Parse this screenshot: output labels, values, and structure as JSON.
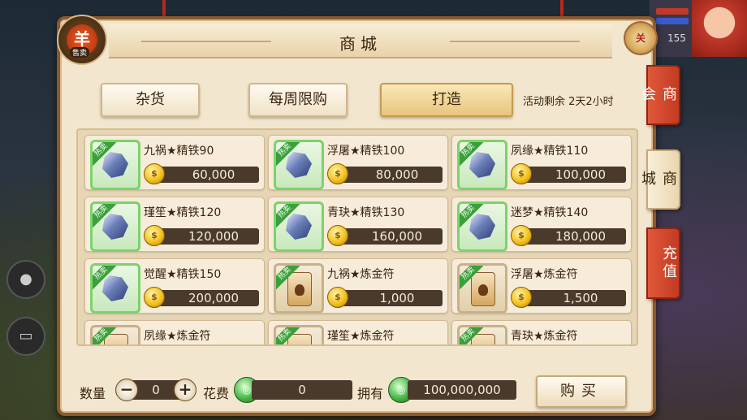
{
  "hud": {
    "level": "155"
  },
  "header": {
    "title": "商城",
    "npc_badge_glyph": "羊",
    "npc_badge_tag": "售卖",
    "close_label": "关"
  },
  "categories": [
    {
      "label": "杂货",
      "active": false
    },
    {
      "label": "每周限购",
      "active": false
    },
    {
      "label": "打造",
      "active": true
    }
  ],
  "activity_remaining": "活动剩余 2天2小时",
  "hot_tag": "热卖",
  "coin_icon": "coin-icon",
  "items": [
    {
      "name": "九祸★精铁90",
      "price": "60,000",
      "icon": "iron-ore-icon",
      "hot": true
    },
    {
      "name": "浮屠★精铁100",
      "price": "80,000",
      "icon": "iron-ore-icon",
      "hot": true
    },
    {
      "name": "夙缘★精铁110",
      "price": "100,000",
      "icon": "iron-ore-icon",
      "hot": true
    },
    {
      "name": "瑾笙★精铁120",
      "price": "120,000",
      "icon": "iron-ore-icon",
      "hot": true
    },
    {
      "name": "青玦★精铁130",
      "price": "160,000",
      "icon": "iron-ore-icon",
      "hot": true
    },
    {
      "name": "迷梦★精铁140",
      "price": "180,000",
      "icon": "iron-ore-icon",
      "hot": true
    },
    {
      "name": "觉醒★精铁150",
      "price": "200,000",
      "icon": "iron-ore-icon",
      "hot": true
    },
    {
      "name": "九祸★炼金符",
      "price": "1,000",
      "icon": "alchemy-talisman-icon",
      "hot": true
    },
    {
      "name": "浮屠★炼金符",
      "price": "1,500",
      "icon": "alchemy-talisman-icon",
      "hot": true
    },
    {
      "name": "夙缘★炼金符",
      "price": "",
      "icon": "alchemy-talisman-icon",
      "hot": true
    },
    {
      "name": "瑾笙★炼金符",
      "price": "",
      "icon": "alchemy-talisman-icon",
      "hot": true
    },
    {
      "name": "青玦★炼金符",
      "price": "",
      "icon": "alchemy-talisman-icon",
      "hot": true
    }
  ],
  "purchase": {
    "quantity_label": "数量",
    "quantity": "0",
    "minus": "−",
    "plus": "+",
    "cost_label": "花费",
    "cost": "0",
    "own_label": "拥有",
    "owned": "100,000,000",
    "buy_label": "购买"
  },
  "side_tabs": [
    {
      "label": "商会",
      "style": "red"
    },
    {
      "label": "商城",
      "style": "light"
    },
    {
      "label": "充值",
      "style": "red"
    }
  ],
  "colors": {
    "panel_bg": "#f2e6cf",
    "panel_border": "#8a5a2e",
    "hot_tag": "#3aa03a",
    "side_tab_red": "#c23b22"
  }
}
